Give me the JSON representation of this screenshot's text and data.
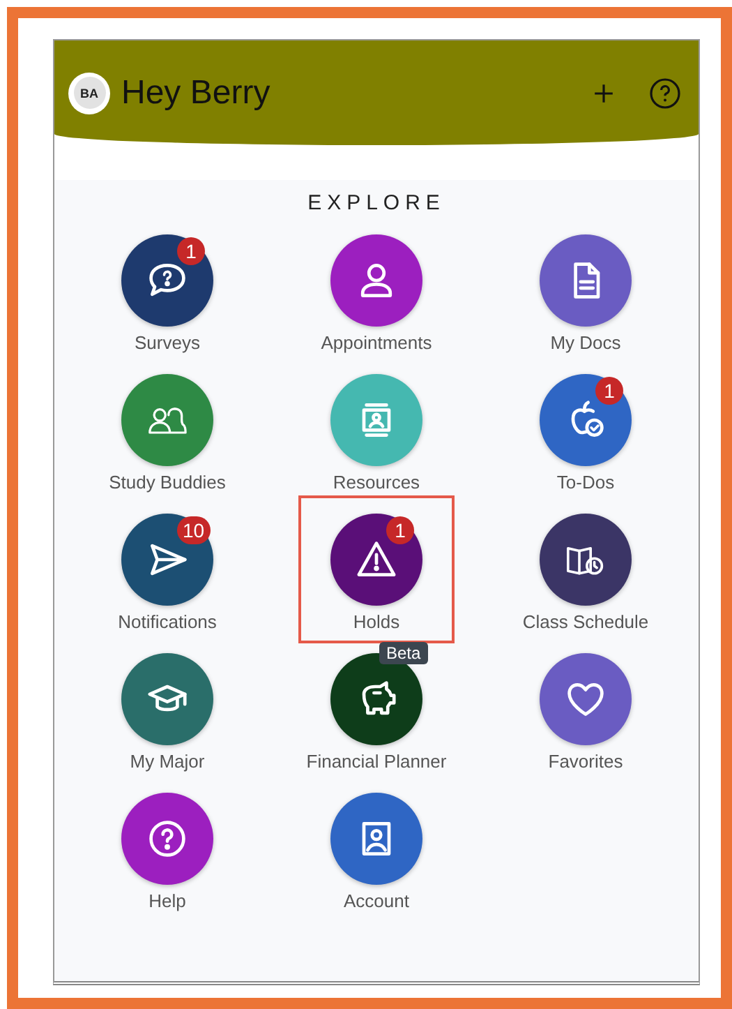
{
  "header": {
    "avatar": "BA",
    "title": "Hey Berry"
  },
  "section_title": "EXPLORE",
  "tiles": [
    {
      "label": "Surveys",
      "color": "#1e3a6e",
      "badge": "1",
      "highlighted": false
    },
    {
      "label": "Appointments",
      "color": "#9c1fbf",
      "highlighted": false
    },
    {
      "label": "My Docs",
      "color": "#6a5cc2",
      "highlighted": false
    },
    {
      "label": "Study Buddies",
      "color": "#2e8a45",
      "highlighted": false
    },
    {
      "label": "Resources",
      "color": "#45b8b0",
      "highlighted": false
    },
    {
      "label": "To-Dos",
      "color": "#2f66c4",
      "badge": "1",
      "highlighted": false
    },
    {
      "label": "Notifications",
      "color": "#1c4f73",
      "badge": "10",
      "highlighted": false
    },
    {
      "label": "Holds",
      "color": "#5a0f78",
      "badge": "1",
      "highlighted": true
    },
    {
      "label": "Class Schedule",
      "color": "#3b3566",
      "highlighted": false
    },
    {
      "label": "My Major",
      "color": "#2a6e6a",
      "highlighted": false
    },
    {
      "label": "Financial Planner",
      "color": "#0e3d1a",
      "tag": "Beta",
      "highlighted": false
    },
    {
      "label": "Favorites",
      "color": "#6a5cc2",
      "highlighted": false
    },
    {
      "label": "Help",
      "color": "#9c1fbf",
      "highlighted": false
    },
    {
      "label": "Account",
      "color": "#2f66c4",
      "highlighted": false
    }
  ]
}
